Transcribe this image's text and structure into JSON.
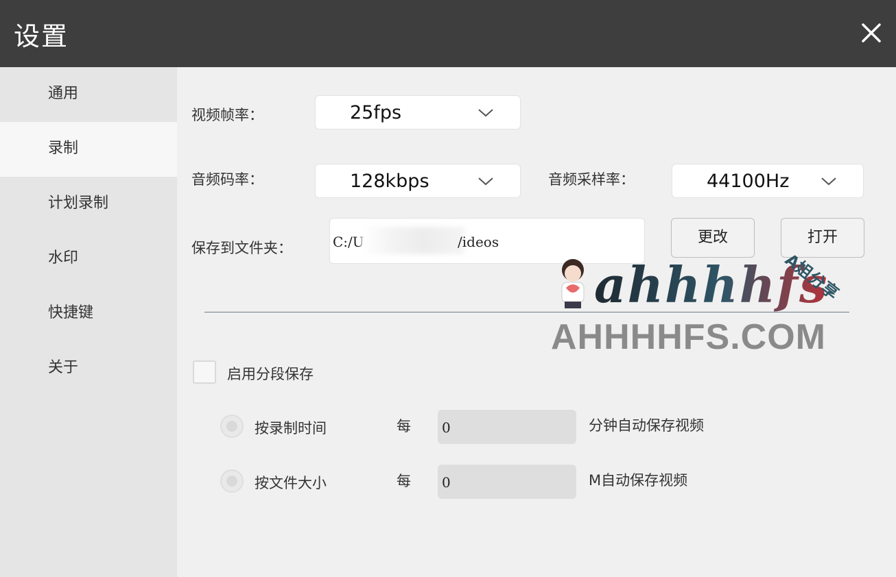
{
  "window": {
    "title": "设置"
  },
  "sidebar": {
    "items": [
      {
        "label": "通用"
      },
      {
        "label": "录制"
      },
      {
        "label": "计划录制"
      },
      {
        "label": "水印"
      },
      {
        "label": "快捷键"
      },
      {
        "label": "关于"
      }
    ],
    "active_index": 1
  },
  "video": {
    "fps_label": "视频帧率：",
    "fps_value": "25fps"
  },
  "audio": {
    "bitrate_label": "音频码率：",
    "bitrate_value": "128kbps",
    "samplerate_label": "音频采样率：",
    "samplerate_value": "44100Hz"
  },
  "save": {
    "folder_label": "保存到文件夹：",
    "path_prefix": "C:/U",
    "path_suffix": "/ideos",
    "change_button": "更改",
    "open_button": "打开"
  },
  "segment": {
    "enable_label": "启用分段保存",
    "enabled": false,
    "by_time_label": "按录制时间",
    "by_time_every": "每",
    "by_time_value": "0",
    "by_time_unit": "分钟自动保存视频",
    "by_size_label": "按文件大小",
    "by_size_every": "每",
    "by_size_value": "0",
    "by_size_unit": "M自动保存视频"
  },
  "watermark": {
    "logo_text": "ahhhhfs",
    "side_text": "A姐分享",
    "url_text": "AHHHHFS.COM",
    "colors": {
      "logo_dark": "#1f2a33",
      "logo_red": "#b5333a",
      "url_gray": "#8a8a8a"
    }
  },
  "colors": {
    "titlebar": "#3e3e3e",
    "sidebar": "#e5e5e5",
    "sidebar_active": "#f7f7f7",
    "content": "#f0f0f0"
  }
}
